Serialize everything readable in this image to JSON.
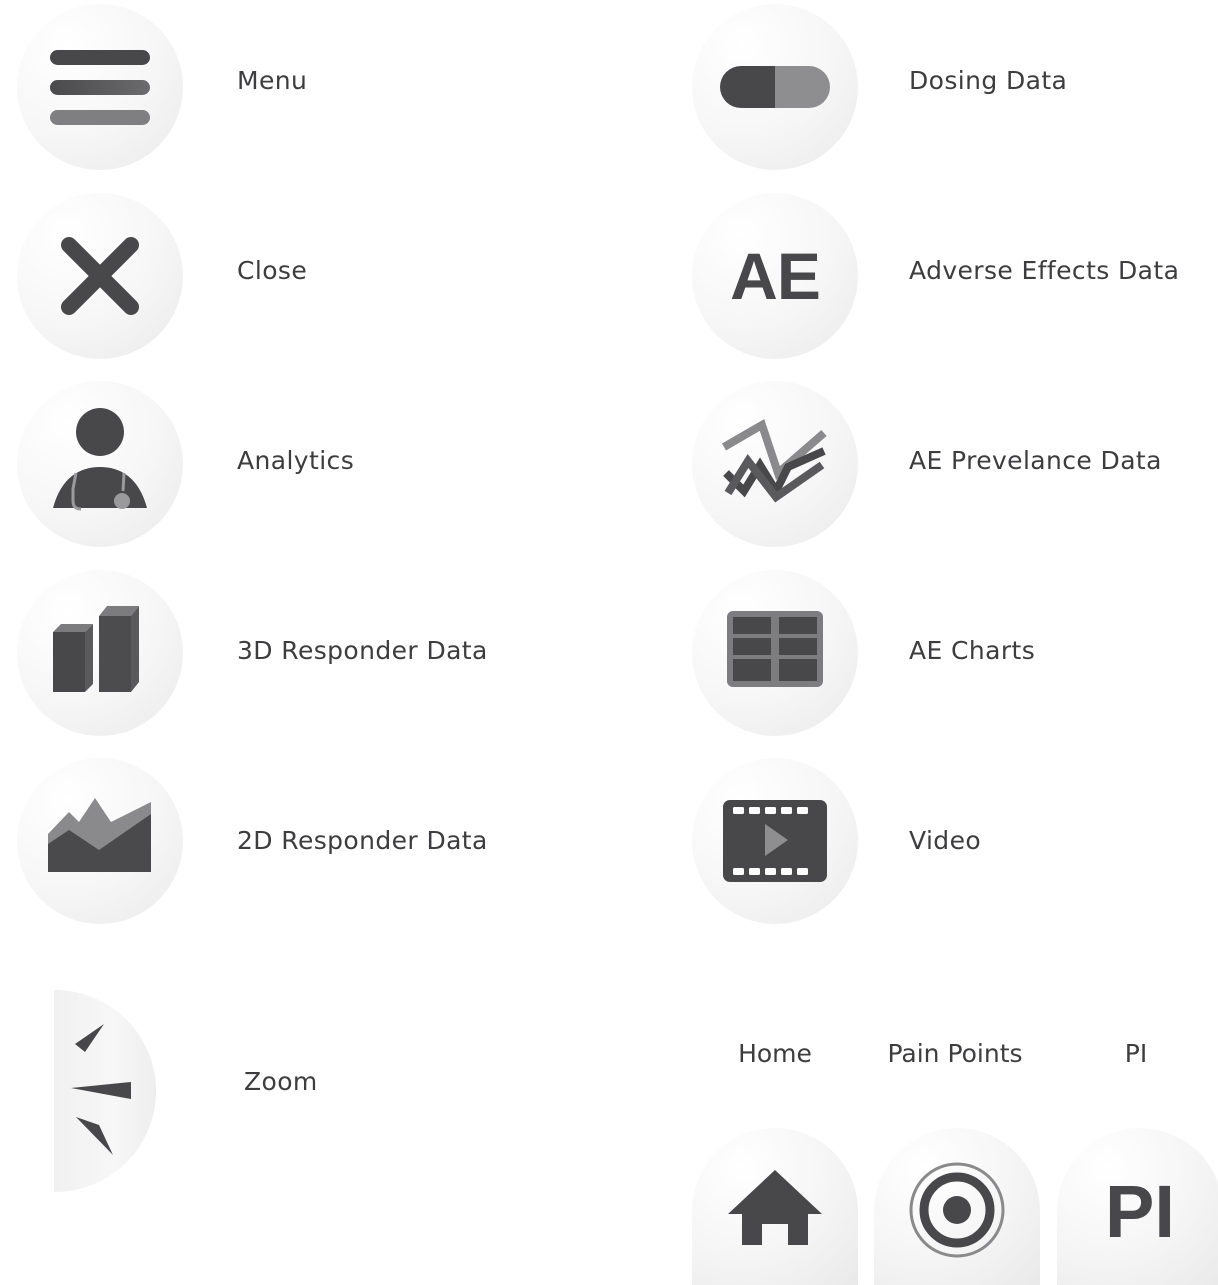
{
  "icons_left": [
    {
      "label": "Menu",
      "icon": "menu-icon"
    },
    {
      "label": "Close",
      "icon": "close-icon"
    },
    {
      "label": "Analytics",
      "icon": "doctor-icon"
    },
    {
      "label": "3D Responder Data",
      "icon": "bar-chart-3d-icon"
    },
    {
      "label": "2D Responder Data",
      "icon": "area-chart-icon"
    }
  ],
  "icons_right": [
    {
      "label": "Dosing Data",
      "icon": "pill-icon"
    },
    {
      "label": "Adverse Effects Data",
      "icon": "ae-icon",
      "glyph": "AE"
    },
    {
      "label": "AE Prevelance Data",
      "icon": "line-chart-icon"
    },
    {
      "label": "AE Charts",
      "icon": "table-icon"
    },
    {
      "label": "Video",
      "icon": "film-play-icon"
    }
  ],
  "zoom": {
    "label": "Zoom",
    "icon": "zoom-icon"
  },
  "tabs": [
    {
      "label": "Home",
      "icon": "home-icon"
    },
    {
      "label": "Pain Points",
      "icon": "target-icon"
    },
    {
      "label": "PI",
      "icon": "pi-icon",
      "glyph": "PI"
    }
  ],
  "colors": {
    "icon_dark": "#48484a",
    "icon_mid": "#79797b",
    "icon_light": "#8e8e90",
    "text": "#3d3d3f"
  }
}
